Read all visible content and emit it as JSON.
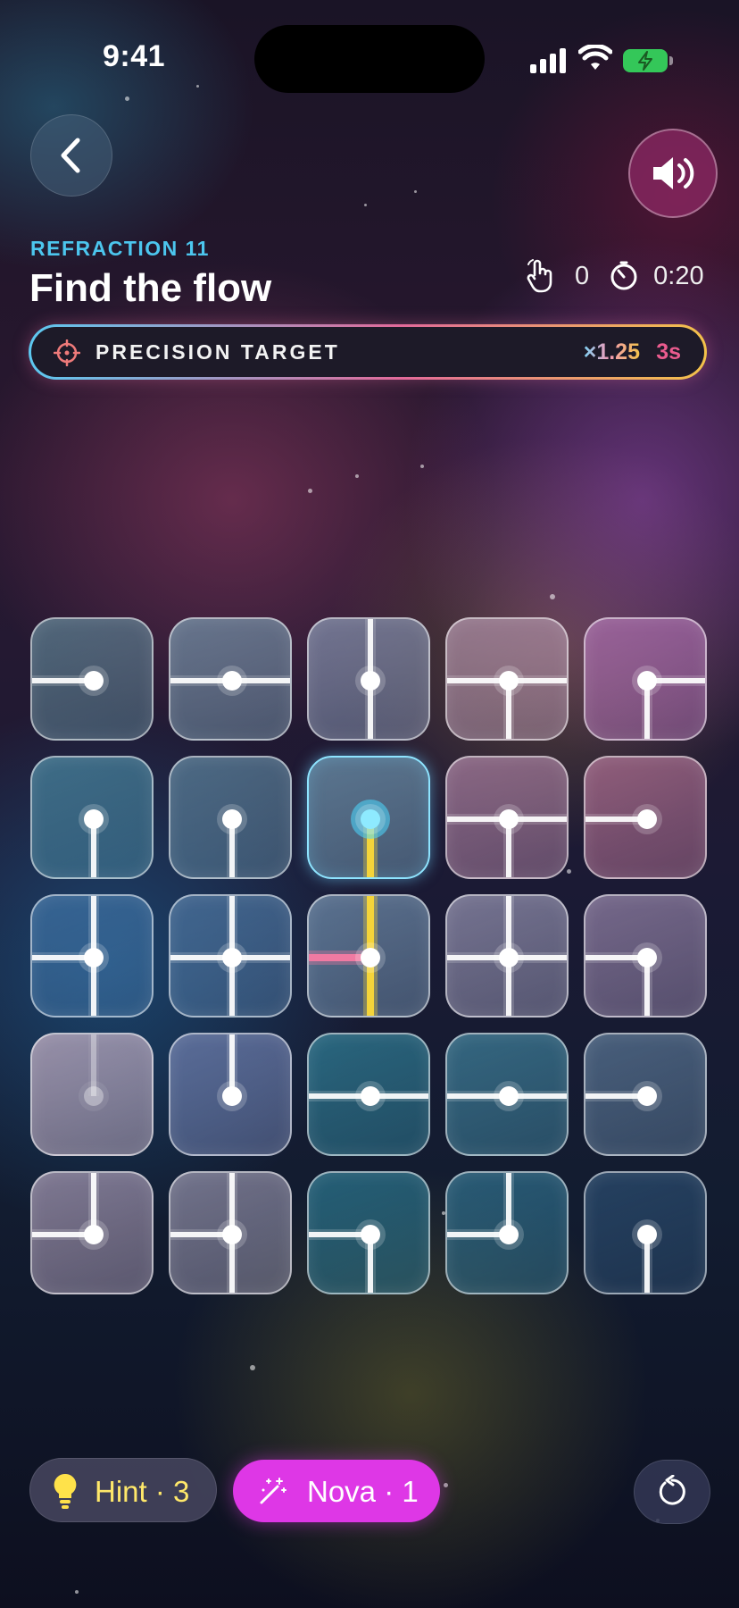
{
  "status_bar": {
    "time": "9:41"
  },
  "header": {
    "level_label": "REFRACTION 11",
    "title": "Find the flow",
    "moves": "0",
    "timer": "0:20"
  },
  "target": {
    "label": "PRECISION TARGET",
    "multiplier": "×1.25",
    "seconds": "3s"
  },
  "grid": {
    "rows": 5,
    "cols": 5,
    "tiles": [
      {
        "arms": [
          "W"
        ],
        "tint": "#5a7a8c"
      },
      {
        "arms": [
          "W",
          "E"
        ],
        "tint": "#6f8aa0"
      },
      {
        "arms": [
          "N",
          "S"
        ],
        "tint": "#7f8aa6"
      },
      {
        "arms": [
          "W",
          "E",
          "S"
        ],
        "tint": "#a88aa0"
      },
      {
        "arms": [
          "E",
          "S"
        ],
        "tint": "#a46aa6"
      },
      {
        "arms": [
          "S"
        ],
        "tint": "#46809a"
      },
      {
        "arms": [
          "S"
        ],
        "tint": "#587c96"
      },
      {
        "arms": [
          "S"
        ],
        "tint": "#6a8ea8",
        "active": true,
        "glow": "cyan",
        "lit": {
          "S": "yellow"
        }
      },
      {
        "arms": [
          "W",
          "E",
          "S"
        ],
        "tint": "#a07898"
      },
      {
        "arms": [
          "W"
        ],
        "tint": "#a56a8c"
      },
      {
        "arms": [
          "N",
          "W",
          "S"
        ],
        "tint": "#3d6fa0"
      },
      {
        "arms": [
          "N",
          "W",
          "E",
          "S"
        ],
        "tint": "#4b729c"
      },
      {
        "arms": [
          "N",
          "W",
          "S"
        ],
        "tint": "#6a86a4",
        "lit": {
          "N": "yellow",
          "S": "yellow",
          "W": "pink"
        }
      },
      {
        "arms": [
          "N",
          "W",
          "E",
          "S"
        ],
        "tint": "#8c8aa8"
      },
      {
        "arms": [
          "W",
          "S"
        ],
        "tint": "#8c7ca0"
      },
      {
        "arms": [
          "N"
        ],
        "tint": "#b7a6bc",
        "dim": true
      },
      {
        "arms": [
          "N"
        ],
        "tint": "#6a7aa8"
      },
      {
        "arms": [
          "W",
          "E"
        ],
        "tint": "#2e7890"
      },
      {
        "arms": [
          "W",
          "E"
        ],
        "tint": "#3c7a94"
      },
      {
        "arms": [
          "W"
        ],
        "tint": "#55708e"
      },
      {
        "arms": [
          "N",
          "W"
        ],
        "tint": "#9a8ea8"
      },
      {
        "arms": [
          "N",
          "W",
          "S"
        ],
        "tint": "#8a88a0"
      },
      {
        "arms": [
          "W",
          "S"
        ],
        "tint": "#2a7088"
      },
      {
        "arms": [
          "N",
          "W"
        ],
        "tint": "#2e6a86"
      },
      {
        "arms": [
          "S"
        ],
        "tint": "#2a4a6c"
      }
    ]
  },
  "actions": {
    "hint_label": "Hint · 3",
    "nova_label": "Nova · 1"
  },
  "colors": {
    "accent_cyan": "#4cc6ee",
    "beam_yellow": "#f4d43a",
    "beam_pink": "#f07aa2",
    "nova": "#de37e6",
    "hint": "#ffe86a"
  },
  "icons": {
    "back": "chevron-left-icon",
    "sound": "speaker-wave-icon",
    "moves": "tap-hand-icon",
    "timer": "stopwatch-icon",
    "target": "crosshair-icon",
    "hint": "lightbulb-icon",
    "nova": "magic-wand-icon",
    "reset": "reset-icon"
  }
}
